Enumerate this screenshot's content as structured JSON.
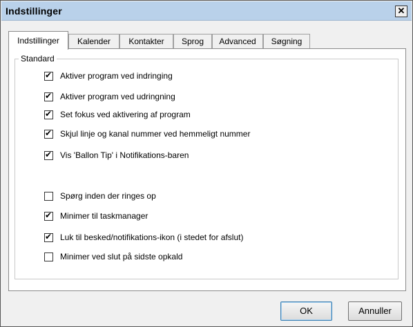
{
  "window": {
    "title": "Indstillinger",
    "close_label": "✕"
  },
  "tabs": [
    {
      "label": "Indstillinger",
      "active": true
    },
    {
      "label": "Kalender",
      "active": false
    },
    {
      "label": "Kontakter",
      "active": false
    },
    {
      "label": "Sprog",
      "active": false
    },
    {
      "label": "Advanced",
      "active": false
    },
    {
      "label": "Søgning",
      "active": false
    }
  ],
  "group": {
    "legend": "Standard"
  },
  "options": [
    {
      "label": "Aktiver program ved indringing",
      "checked": true
    },
    {
      "label": "Aktiver program ved udringning",
      "checked": true
    },
    {
      "label": "Set fokus ved aktivering af program",
      "checked": true
    },
    {
      "label": "Skjul linje og kanal nummer ved hemmeligt nummer",
      "checked": true
    },
    {
      "label": "Vis 'Ballon Tip' i Notifikations-baren",
      "checked": true
    },
    {
      "label": "Spørg inden der ringes op",
      "checked": false
    },
    {
      "label": "Minimer til taskmanager",
      "checked": true
    },
    {
      "label": "Luk til besked/notifikations-ikon (i stedet for afslut)",
      "checked": true
    },
    {
      "label": "Minimer ved slut på sidste opkald",
      "checked": false
    }
  ],
  "buttons": {
    "ok": "OK",
    "cancel": "Annuller"
  }
}
